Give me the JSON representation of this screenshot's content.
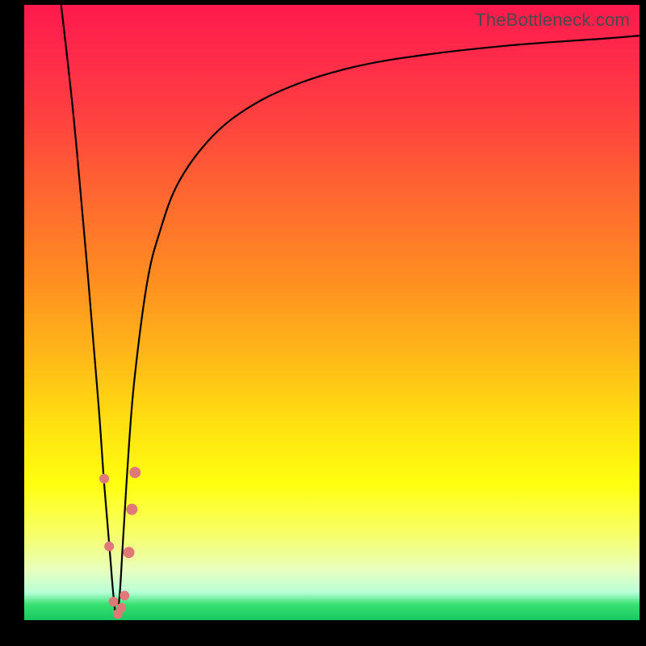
{
  "watermark": "TheBottleneck.com",
  "chart_data": {
    "type": "line",
    "title": "",
    "xlabel": "",
    "ylabel": "",
    "xlim": [
      0,
      100
    ],
    "ylim": [
      0,
      100
    ],
    "series": [
      {
        "name": "bottleneck-curve",
        "x": [
          6,
          8,
          10,
          12,
          13,
          14,
          14.5,
          15,
          15.5,
          16,
          17,
          18,
          20,
          22,
          25,
          30,
          36,
          44,
          54,
          66,
          80,
          94,
          100
        ],
        "y": [
          100,
          82,
          60,
          36,
          22,
          10,
          4,
          0.5,
          4,
          12,
          28,
          40,
          55,
          63,
          71,
          78,
          83,
          87,
          90,
          92,
          93.5,
          94.5,
          95
        ]
      }
    ],
    "markers": {
      "name": "highlight-points",
      "color": "#e07878",
      "points": [
        {
          "x": 13.0,
          "y": 23.0,
          "r": 6
        },
        {
          "x": 13.8,
          "y": 12.0,
          "r": 6
        },
        {
          "x": 14.5,
          "y": 3.0,
          "r": 6
        },
        {
          "x": 15.2,
          "y": 1.0,
          "r": 6
        },
        {
          "x": 15.8,
          "y": 2.0,
          "r": 6
        },
        {
          "x": 16.3,
          "y": 4.0,
          "r": 6
        },
        {
          "x": 17.0,
          "y": 11.0,
          "r": 7
        },
        {
          "x": 17.5,
          "y": 18.0,
          "r": 7
        },
        {
          "x": 18.0,
          "y": 24.0,
          "r": 7
        }
      ]
    }
  }
}
